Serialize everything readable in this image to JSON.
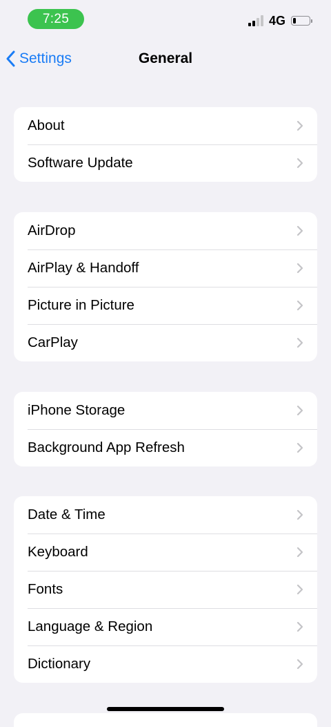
{
  "status_bar": {
    "time": "7:25",
    "network": "4G",
    "signal_bars_active": 2,
    "signal_bars_total": 4,
    "battery_level": 0.2,
    "time_pill_color": "#3cc34f"
  },
  "nav": {
    "back_label": "Settings",
    "title": "General",
    "accent_color": "#1a7cf5"
  },
  "groups": [
    {
      "items": [
        "About",
        "Software Update"
      ]
    },
    {
      "items": [
        "AirDrop",
        "AirPlay & Handoff",
        "Picture in Picture",
        "CarPlay"
      ]
    },
    {
      "items": [
        "iPhone Storage",
        "Background App Refresh"
      ]
    },
    {
      "items": [
        "Date & Time",
        "Keyboard",
        "Fonts",
        "Language & Region",
        "Dictionary"
      ]
    }
  ],
  "icons": {
    "back": "chevron-left-icon",
    "row": "chevron-right-icon"
  }
}
